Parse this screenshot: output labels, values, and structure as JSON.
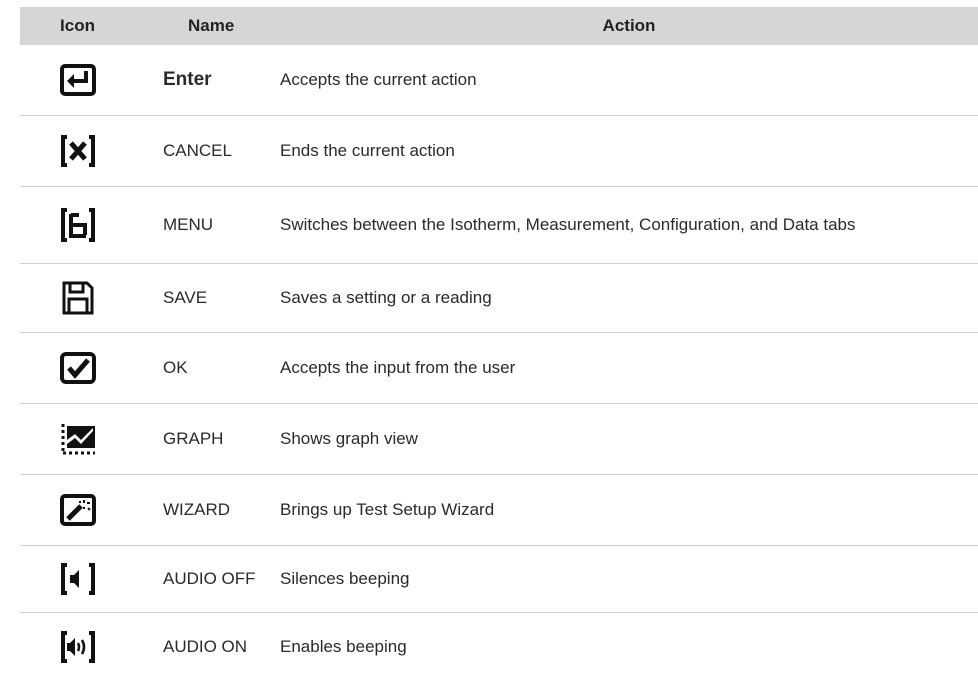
{
  "header": {
    "icon": "Icon",
    "name": "Name",
    "action": "Action"
  },
  "rows": [
    {
      "icon": "enter-icon",
      "name": "Enter",
      "action": "Accepts the current action"
    },
    {
      "icon": "cancel-icon",
      "name": "CANCEL",
      "action": "Ends the current action"
    },
    {
      "icon": "menu-icon",
      "name": "MENU",
      "action": "Switches between the Isotherm, Measurement, Configuration, and Data tabs"
    },
    {
      "icon": "save-icon",
      "name": "SAVE",
      "action": "Saves a setting or a reading"
    },
    {
      "icon": "ok-icon",
      "name": "OK",
      "action": "Accepts the input from the user"
    },
    {
      "icon": "graph-icon",
      "name": "GRAPH",
      "action": "Shows graph view"
    },
    {
      "icon": "wizard-icon",
      "name": "WIZARD",
      "action": "Brings up Test Setup Wizard"
    },
    {
      "icon": "audio-off-icon",
      "name": "AUDIO OFF",
      "action": "Silences beeping"
    },
    {
      "icon": "audio-on-icon",
      "name": "AUDIO ON",
      "action": "Enables beeping"
    }
  ]
}
